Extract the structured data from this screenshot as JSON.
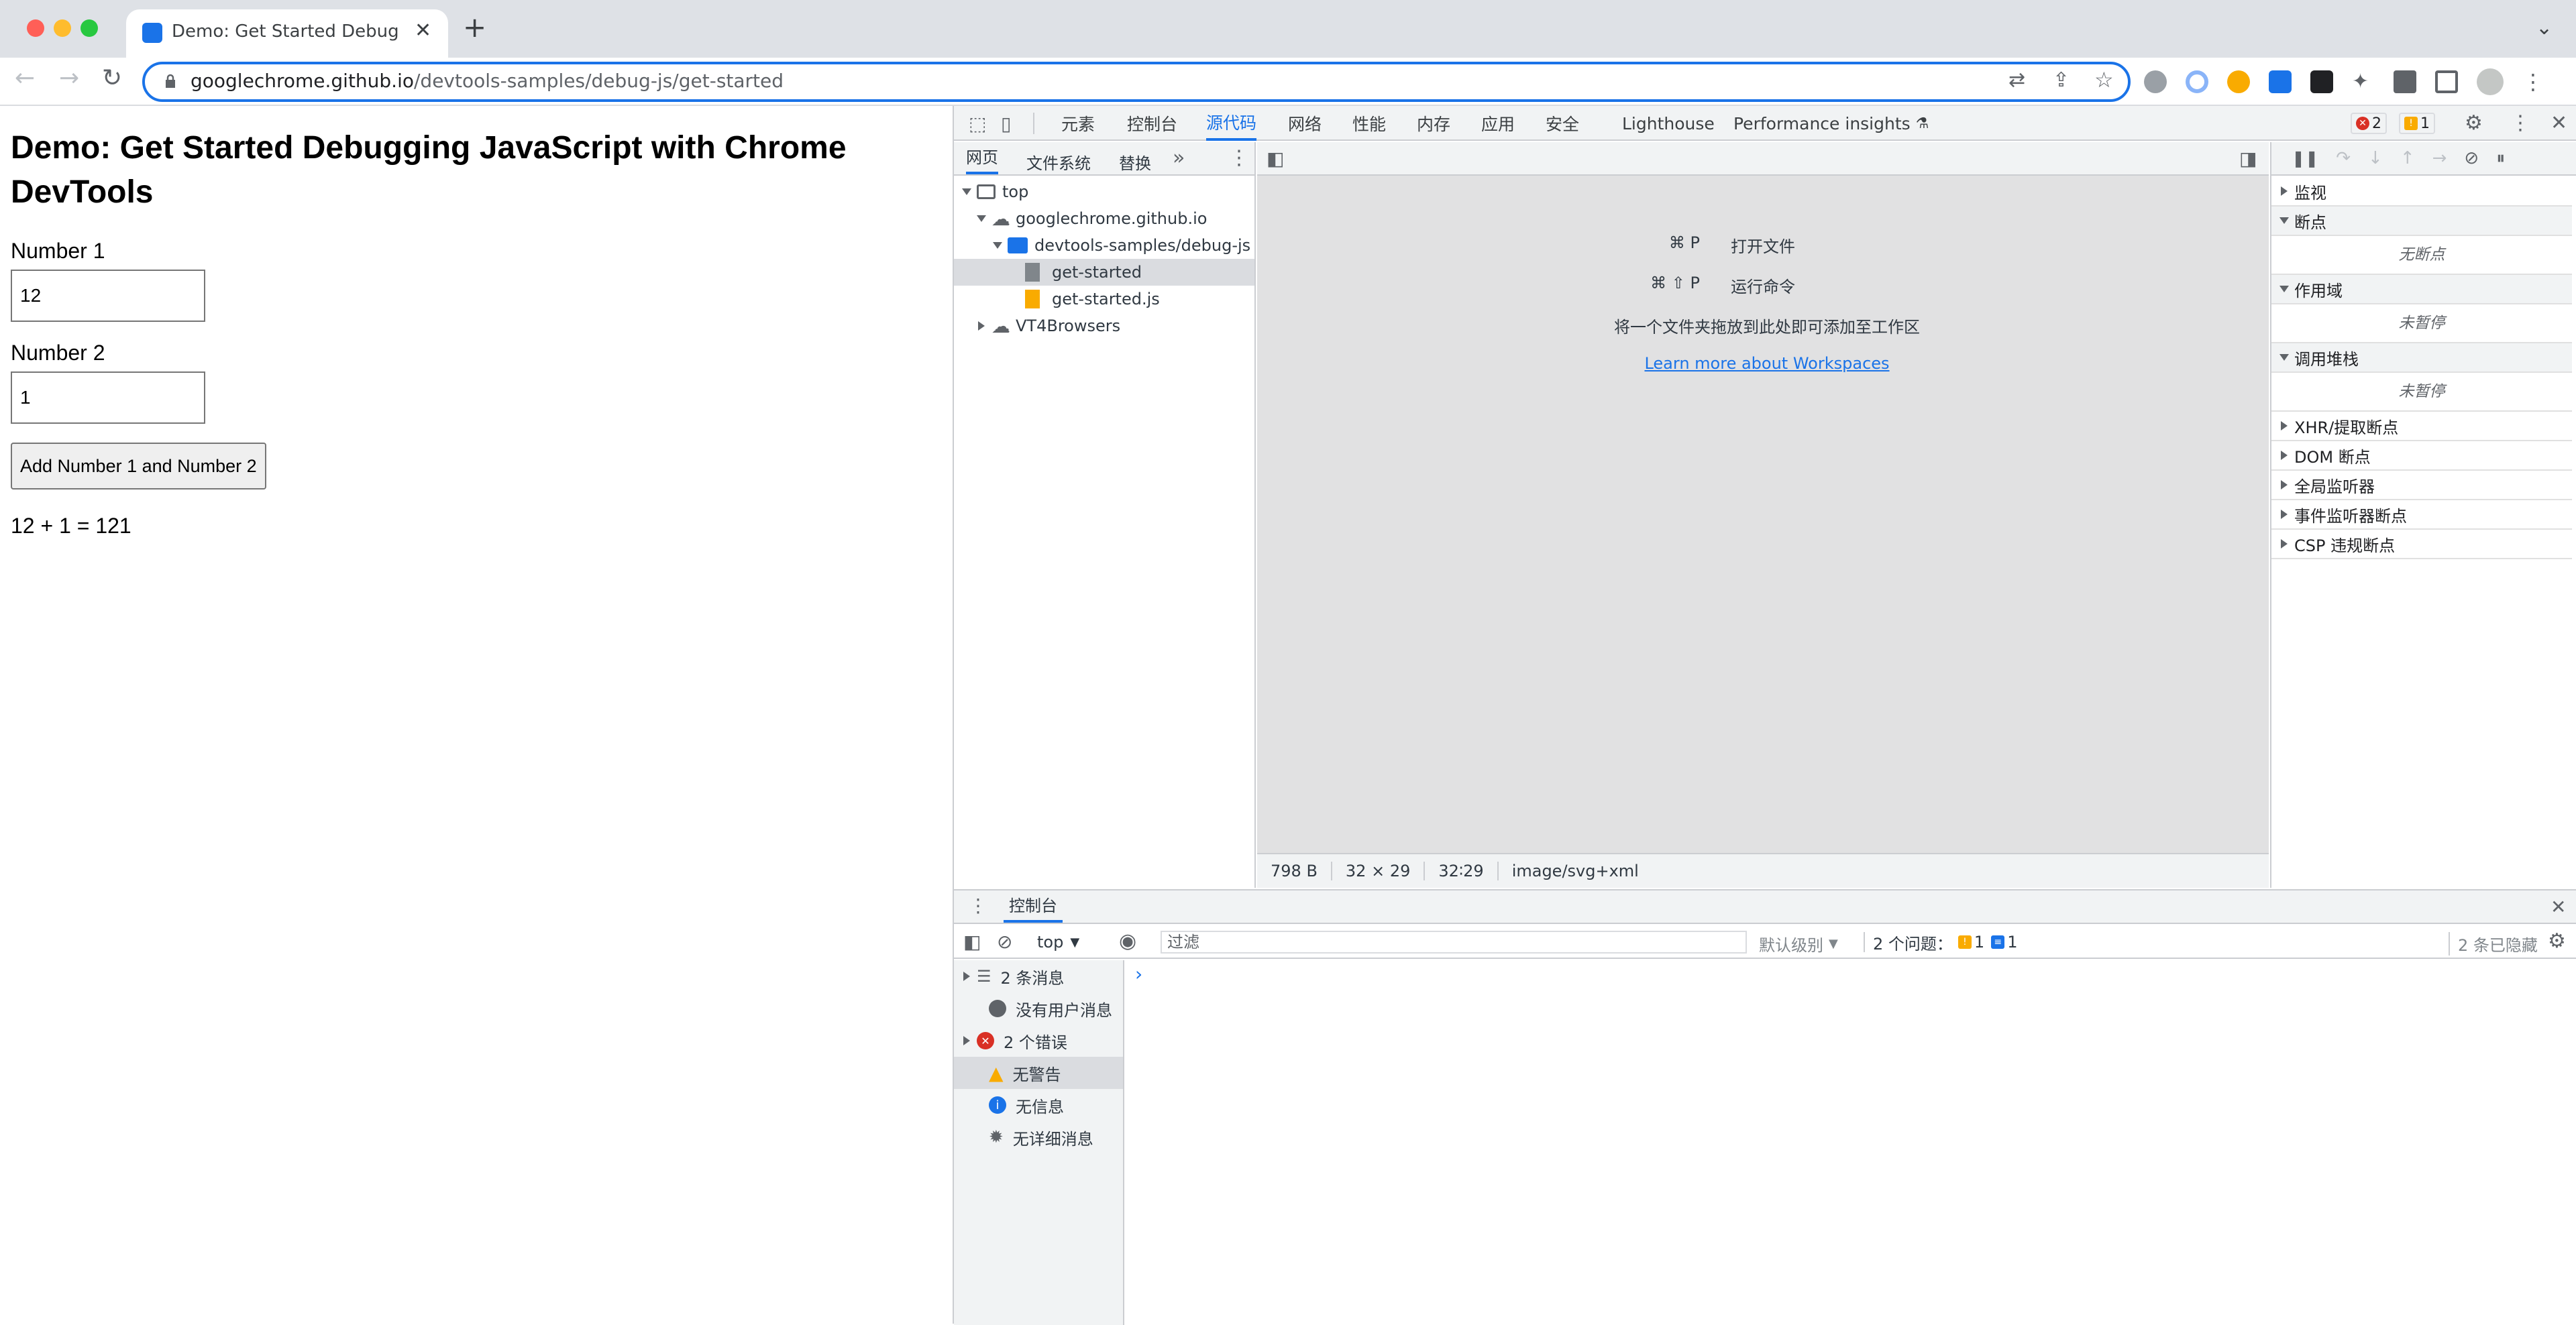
{
  "browser": {
    "tab_title": "Demo: Get Started Debugging",
    "url_host": "googlechrome.github.io",
    "url_path": "/devtools-samples/debug-js/get-started"
  },
  "page": {
    "heading": "Demo: Get Started Debugging JavaScript with Chrome DevTools",
    "number1_label": "Number 1",
    "number1_value": "12",
    "number2_label": "Number 2",
    "number2_value": "1",
    "button_label": "Add Number 1 and Number 2",
    "result": "12 + 1 = 121"
  },
  "devtools": {
    "tabs": [
      "元素",
      "控制台",
      "源代码",
      "网络",
      "性能",
      "内存",
      "应用",
      "安全",
      "Lighthouse",
      "Performance insights"
    ],
    "active_tab": "源代码",
    "error_count": "2",
    "warning_count": "1",
    "navigator_tabs": [
      "网页",
      "文件系统",
      "替换"
    ],
    "tree": {
      "top": "top",
      "domain": "googlechrome.github.io",
      "folder": "devtools-samples/debug-js",
      "file1": "get-started",
      "file2": "get-started.js",
      "vt": "VT4Browsers"
    },
    "editor": {
      "shortcut1_keys": "⌘ P",
      "shortcut1_label": "打开文件",
      "shortcut2_keys": "⌘ ⇧ P",
      "shortcut2_label": "运行命令",
      "drop_hint": "将一个文件夹拖放到此处即可添加至工作区",
      "link": "Learn more about Workspaces"
    },
    "status": {
      "size": "798 B",
      "dims": "32 × 29",
      "pos": "32∶29",
      "mime": "image/svg+xml"
    },
    "debugger": {
      "watch": "监视",
      "breakpoints": "断点",
      "no_breakpoints": "无断点",
      "scope": "作用域",
      "not_paused": "未暂停",
      "callstack": "调用堆栈",
      "not_paused2": "未暂停",
      "xhr": "XHR/提取断点",
      "dom": "DOM 断点",
      "global": "全局监听器",
      "event": "事件监听器断点",
      "csp": "CSP 违规断点"
    },
    "drawer": {
      "tab": "控制台",
      "context": "top",
      "filter_placeholder": "过滤",
      "level": "默认级别",
      "issues_label": "2 个问题：",
      "issues_warn": "1",
      "issues_info": "1",
      "hidden": "2 条已隐藏",
      "sidebar": [
        "2 条消息",
        "没有用户消息",
        "2 个错误",
        "无警告",
        "无信息",
        "无详细消息"
      ],
      "prompt": "›"
    }
  }
}
